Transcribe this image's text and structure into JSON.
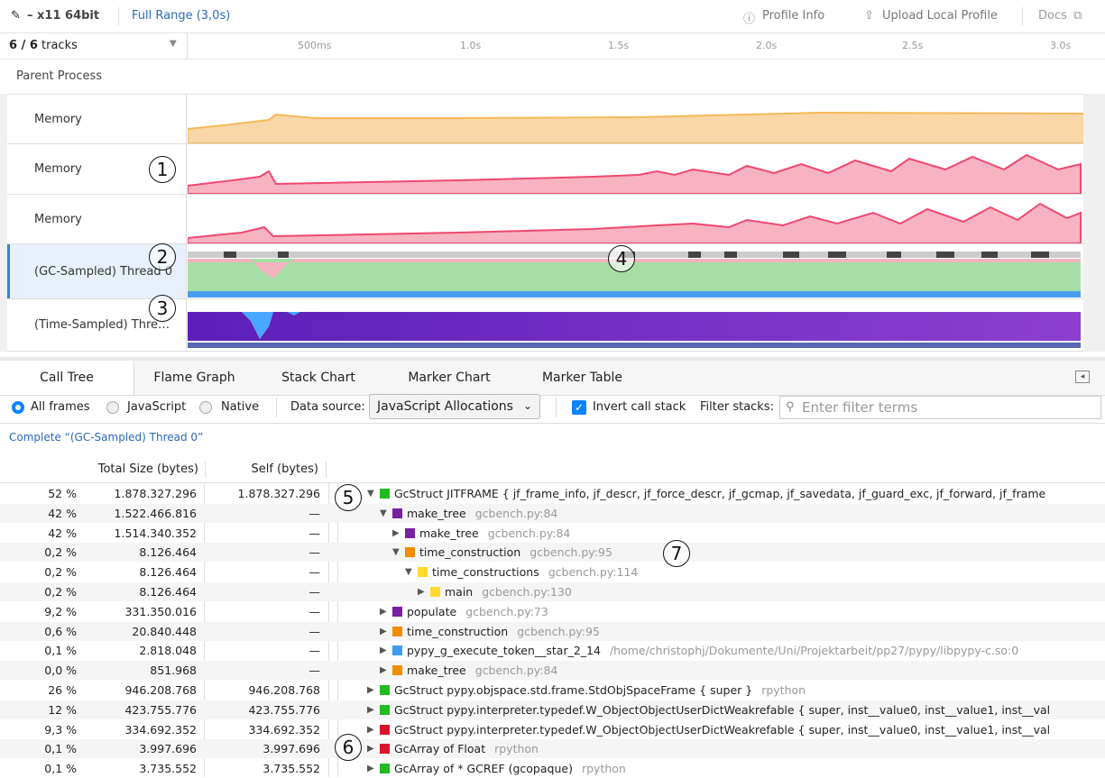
{
  "topbar": {
    "title": "– x11 64bit",
    "range": "Full Range (3,0s)",
    "profile_info": "Profile Info",
    "upload": "Upload Local Profile",
    "docs": "Docs"
  },
  "tracks_header": {
    "count_bold": "6 / 6",
    "count_suffix": " tracks",
    "ticks": [
      "500ms",
      "1.0s",
      "1.5s",
      "2.0s",
      "2.5s",
      "3.0s"
    ]
  },
  "parent_process": "Parent Process",
  "tracks": [
    {
      "label": "Memory",
      "color": "#f5b95a"
    },
    {
      "label": "Memory",
      "color": "#ef4870"
    },
    {
      "label": "Memory",
      "color": "#ef4870"
    },
    {
      "label": "(GC-Sampled) Thread 0",
      "selected": true
    },
    {
      "label": "(Time-Sampled) Thre…"
    }
  ],
  "tabs": [
    "Call Tree",
    "Flame Graph",
    "Stack Chart",
    "Marker Chart",
    "Marker Table"
  ],
  "options": {
    "frames": [
      "All frames",
      "JavaScript",
      "Native"
    ],
    "data_source_label": "Data source:",
    "data_source_value": "JavaScript Allocations",
    "invert_label": "Invert call stack",
    "filter_label": "Filter stacks:",
    "filter_placeholder": "Enter filter terms"
  },
  "breadcrumb": "Complete “(GC-Sampled) Thread 0”",
  "table": {
    "headers": [
      "Total Size (bytes)",
      "Self (bytes)"
    ],
    "rows": [
      {
        "pct": "52 %",
        "total": "1.878.327.296",
        "self": "1.878.327.296",
        "depth": 0,
        "tw": "▼",
        "color": "#22bb22",
        "name": "GcStruct JITFRAME { jf_frame_info, jf_descr, jf_force_descr, jf_gcmap, jf_savedata, jf_guard_exc, jf_forward, jf_frame",
        "lib": ""
      },
      {
        "pct": "42 %",
        "total": "1.522.466.816",
        "self": "—",
        "depth": 1,
        "tw": "▼",
        "color": "#7a1fa2",
        "name": "make_tree",
        "lib": "gcbench.py:84"
      },
      {
        "pct": "42 %",
        "total": "1.514.340.352",
        "self": "—",
        "depth": 2,
        "tw": "▶",
        "color": "#7a1fa2",
        "name": "make_tree",
        "lib": "gcbench.py:84"
      },
      {
        "pct": "0,2 %",
        "total": "8.126.464",
        "self": "—",
        "depth": 2,
        "tw": "▼",
        "color": "#f28c00",
        "name": "time_construction",
        "lib": "gcbench.py:95"
      },
      {
        "pct": "0,2 %",
        "total": "8.126.464",
        "self": "—",
        "depth": 3,
        "tw": "▼",
        "color": "#ffd92e",
        "name": "time_constructions",
        "lib": "gcbench.py:114"
      },
      {
        "pct": "0,2 %",
        "total": "8.126.464",
        "self": "—",
        "depth": 4,
        "tw": "▶",
        "color": "#ffd92e",
        "name": "main",
        "lib": "gcbench.py:130"
      },
      {
        "pct": "9,2 %",
        "total": "331.350.016",
        "self": "—",
        "depth": 1,
        "tw": "▶",
        "color": "#7a1fa2",
        "name": "populate",
        "lib": "gcbench.py:73"
      },
      {
        "pct": "0,6 %",
        "total": "20.840.448",
        "self": "—",
        "depth": 1,
        "tw": "▶",
        "color": "#f28c00",
        "name": "time_construction",
        "lib": "gcbench.py:95"
      },
      {
        "pct": "0,1 %",
        "total": "2.818.048",
        "self": "—",
        "depth": 1,
        "tw": "▶",
        "color": "#3d9cf0",
        "name": "pypy_g_execute_token__star_2_14",
        "lib": "/home/christophj/Dokumente/Uni/Projektarbeit/pp27/pypy/libpypy-c.so:0"
      },
      {
        "pct": "0,0 %",
        "total": "851.968",
        "self": "—",
        "depth": 1,
        "tw": "▶",
        "color": "#f28c00",
        "name": "make_tree",
        "lib": "gcbench.py:84"
      },
      {
        "pct": "26 %",
        "total": "946.208.768",
        "self": "946.208.768",
        "depth": 0,
        "tw": "▶",
        "color": "#22bb22",
        "name": "GcStruct pypy.objspace.std.frame.StdObjSpaceFrame { super }",
        "lib": "rpython"
      },
      {
        "pct": "12 %",
        "total": "423.755.776",
        "self": "423.755.776",
        "depth": 0,
        "tw": "▶",
        "color": "#22bb22",
        "name": "GcStruct pypy.interpreter.typedef.W_ObjectObjectUserDictWeakrefable { super, inst__value0, inst__value1, inst__val",
        "lib": ""
      },
      {
        "pct": "9,3 %",
        "total": "334.692.352",
        "self": "334.692.352",
        "depth": 0,
        "tw": "▶",
        "color": "#d9132e",
        "name": "GcStruct pypy.interpreter.typedef.W_ObjectObjectUserDictWeakrefable { super, inst__value0, inst__value1, inst__val",
        "lib": ""
      },
      {
        "pct": "0,1 %",
        "total": "3.997.696",
        "self": "3.997.696",
        "depth": 0,
        "tw": "▶",
        "color": "#d9132e",
        "name": "GcArray of Float",
        "lib": "rpython"
      },
      {
        "pct": "0,1 %",
        "total": "3.735.552",
        "self": "3.735.552",
        "depth": 0,
        "tw": "▶",
        "color": "#22bb22",
        "name": "GcArray of * GCREF (gcopaque)",
        "lib": "rpython"
      }
    ]
  },
  "callouts": [
    "1",
    "2",
    "3",
    "4",
    "5",
    "6",
    "7"
  ]
}
